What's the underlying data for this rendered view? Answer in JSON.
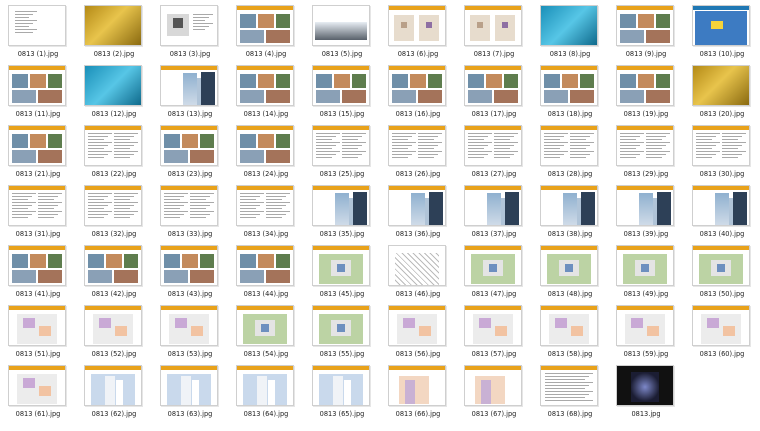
{
  "window": {
    "title": ""
  },
  "colors": {
    "header_orange": "#e8a21b",
    "header_blue": "#1f78b4",
    "selection": "#cce4fa"
  },
  "files": [
    {
      "name": "0813 (1).jpg",
      "style": "toc"
    },
    {
      "name": "0813 (2).jpg",
      "style": "gold"
    },
    {
      "name": "0813 (3).jpg",
      "style": "map"
    },
    {
      "name": "0813 (4).jpg",
      "style": "photos"
    },
    {
      "name": "0813 (5).jpg",
      "style": "skyline"
    },
    {
      "name": "0813 (6).jpg",
      "style": "diagram"
    },
    {
      "name": "0813 (7).jpg",
      "style": "diagram"
    },
    {
      "name": "0813 (8).jpg",
      "style": "teal"
    },
    {
      "name": "0813 (9).jpg",
      "style": "photos"
    },
    {
      "name": "0813 (10).jpg",
      "style": "bluemap"
    },
    {
      "name": "0813 (11).jpg",
      "style": "photos"
    },
    {
      "name": "0813 (12).jpg",
      "style": "teal"
    },
    {
      "name": "0813 (13).jpg",
      "style": "tower"
    },
    {
      "name": "0813 (14).jpg",
      "style": "photos"
    },
    {
      "name": "0813 (15).jpg",
      "style": "photos"
    },
    {
      "name": "0813 (16).jpg",
      "style": "photos"
    },
    {
      "name": "0813 (17).jpg",
      "style": "photos"
    },
    {
      "name": "0813 (18).jpg",
      "style": "photos"
    },
    {
      "name": "0813 (19).jpg",
      "style": "photos"
    },
    {
      "name": "0813 (20).jpg",
      "style": "gold"
    },
    {
      "name": "0813 (21).jpg",
      "style": "photos"
    },
    {
      "name": "0813 (22).jpg",
      "style": "text"
    },
    {
      "name": "0813 (23).jpg",
      "style": "photos"
    },
    {
      "name": "0813 (24).jpg",
      "style": "photos"
    },
    {
      "name": "0813 (25).jpg",
      "style": "text"
    },
    {
      "name": "0813 (26).jpg",
      "style": "text"
    },
    {
      "name": "0813 (27).jpg",
      "style": "text"
    },
    {
      "name": "0813 (28).jpg",
      "style": "text"
    },
    {
      "name": "0813 (29).jpg",
      "style": "text"
    },
    {
      "name": "0813 (30).jpg",
      "style": "text"
    },
    {
      "name": "0813 (31).jpg",
      "style": "text"
    },
    {
      "name": "0813 (32).jpg",
      "style": "text"
    },
    {
      "name": "0813 (33).jpg",
      "style": "text"
    },
    {
      "name": "0813 (34).jpg",
      "style": "text"
    },
    {
      "name": "0813 (35).jpg",
      "style": "tower"
    },
    {
      "name": "0813 (36).jpg",
      "style": "tower"
    },
    {
      "name": "0813 (37).jpg",
      "style": "tower"
    },
    {
      "name": "0813 (38).jpg",
      "style": "tower"
    },
    {
      "name": "0813 (39).jpg",
      "style": "tower"
    },
    {
      "name": "0813 (40).jpg",
      "style": "tower"
    },
    {
      "name": "0813 (41).jpg",
      "style": "photos"
    },
    {
      "name": "0813 (42).jpg",
      "style": "photos"
    },
    {
      "name": "0813 (43).jpg",
      "style": "photos"
    },
    {
      "name": "0813 (44).jpg",
      "style": "photos"
    },
    {
      "name": "0813 (45).jpg",
      "style": "plan"
    },
    {
      "name": "0813 (46).jpg",
      "style": "lineplan"
    },
    {
      "name": "0813 (47).jpg",
      "style": "plan"
    },
    {
      "name": "0813 (48).jpg",
      "style": "plan"
    },
    {
      "name": "0813 (49).jpg",
      "style": "plan"
    },
    {
      "name": "0813 (50).jpg",
      "style": "plan"
    },
    {
      "name": "0813 (51).jpg",
      "style": "floor"
    },
    {
      "name": "0813 (52).jpg",
      "style": "floor"
    },
    {
      "name": "0813 (53).jpg",
      "style": "floor"
    },
    {
      "name": "0813 (54).jpg",
      "style": "plan"
    },
    {
      "name": "0813 (55).jpg",
      "style": "plan"
    },
    {
      "name": "0813 (56).jpg",
      "style": "floor"
    },
    {
      "name": "0813 (57).jpg",
      "style": "floor"
    },
    {
      "name": "0813 (58).jpg",
      "style": "floor"
    },
    {
      "name": "0813 (59).jpg",
      "style": "floor"
    },
    {
      "name": "0813 (60).jpg",
      "style": "floor"
    },
    {
      "name": "0813 (61).jpg",
      "style": "floor"
    },
    {
      "name": "0813 (62).jpg",
      "style": "elevation"
    },
    {
      "name": "0813 (63).jpg",
      "style": "elevation"
    },
    {
      "name": "0813 (64).jpg",
      "style": "elevation"
    },
    {
      "name": "0813 (65).jpg",
      "style": "elevation"
    },
    {
      "name": "0813 (66).jpg",
      "style": "section"
    },
    {
      "name": "0813 (67).jpg",
      "style": "section"
    },
    {
      "name": "0813 (68).jpg",
      "style": "table"
    },
    {
      "name": "0813.jpg",
      "style": "night"
    }
  ]
}
